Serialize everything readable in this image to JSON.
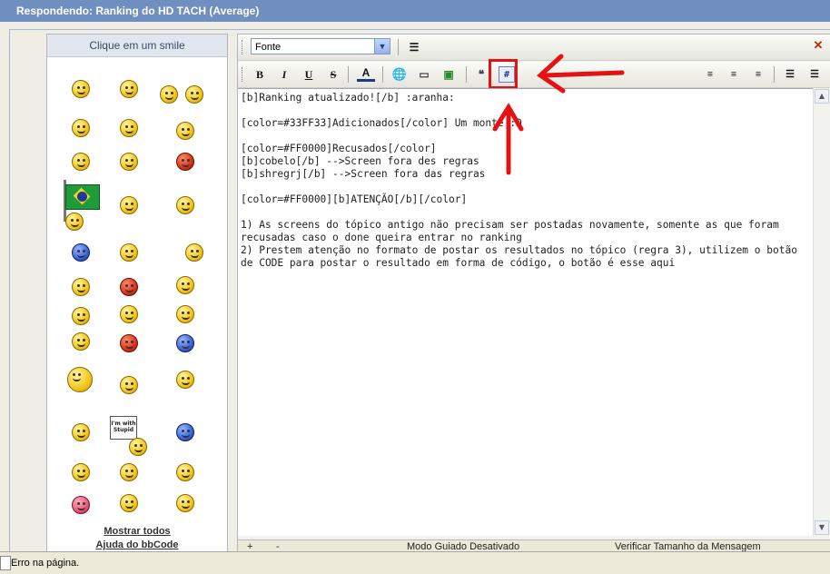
{
  "window": {
    "title": "Respondendo: Ranking do HD TACH (Average)"
  },
  "smilies": {
    "header": "Clique em um smile",
    "sign_text": "I'm with Stupid",
    "show_all": "Mostrar todos",
    "bbcode_help": "Ajuda do bbCode"
  },
  "toolbar": {
    "font_select": "Fonte",
    "bold": "B",
    "italic": "I",
    "underline": "U",
    "strike": "S",
    "font_color": "A",
    "code": "#"
  },
  "editor": {
    "content": "[b]Ranking atualizado![/b] :aranha:\n\n[color=#33FF33]Adicionados[/color] Um monte :D\n\n[color=#FF0000]Recusados[/color]\n[b]cobelo[/b] -->Screen fora des regras\n[b]shregrj[/b] -->Screen fora das regras\n\n[color=#FF0000][b]ATENÇÃO[/b][/color]\n\n1) As screens do tópico antigo não precisam ser postadas novamente, somente as que foram recusadas caso o done queira entrar no ranking\n2) Prestem atenção no formato de postar os resultados no tópico (regra 3), utilizem o botão de CODE para postar o resultado em forma de código, o botão é esse aqui\n",
    "bottom_plus": "+",
    "bottom_minus": "-",
    "mode_label": "Modo Guiado Desativado",
    "verify_label": "Verificar Tamanho da Mensagem"
  },
  "status": {
    "text": "Erro na página."
  },
  "colors": {
    "title_bg": "#6f8fc1",
    "annotation": "#e41212"
  }
}
